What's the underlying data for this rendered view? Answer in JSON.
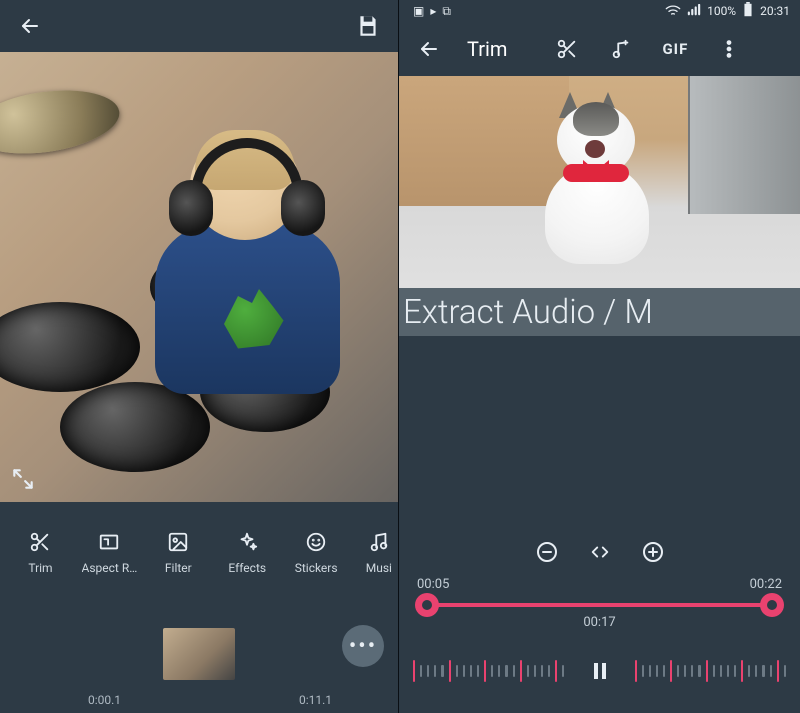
{
  "left": {
    "toolbar": {
      "back_icon": "arrow-left",
      "save_icon": "save"
    },
    "tools": [
      {
        "icon": "scissors",
        "label": "Trim"
      },
      {
        "icon": "aspect",
        "label": "Aspect R…"
      },
      {
        "icon": "filter",
        "label": "Filter"
      },
      {
        "icon": "effects",
        "label": "Effects"
      },
      {
        "icon": "stickers",
        "label": "Stickers"
      },
      {
        "icon": "music",
        "label": "Musi"
      }
    ],
    "timeline": {
      "current": "0:00.1",
      "total": "0:11.1",
      "more_icon": "more-horizontal"
    },
    "fullscreen_icon": "fullscreen"
  },
  "right": {
    "status": {
      "left_icons": [
        "camera",
        "youtube",
        "cast"
      ],
      "wifi_icon": "wifi",
      "signal_icon": "signal",
      "battery_text": "100%",
      "battery_icon": "battery-full",
      "time": "20:31"
    },
    "toolbar": {
      "back_icon": "arrow-left",
      "title": "Trim",
      "icons": [
        "scissors",
        "add-music",
        "gif",
        "more-vertical"
      ],
      "gif_label": "GIF"
    },
    "overlay_text": "Extract Audio / M",
    "zoom": {
      "minus_icon": "minus-circle",
      "code_icon": "code",
      "plus_icon": "plus-circle"
    },
    "range": {
      "start": "00:05",
      "end": "00:22",
      "mid": "00:17"
    },
    "play_icon": "pause"
  }
}
